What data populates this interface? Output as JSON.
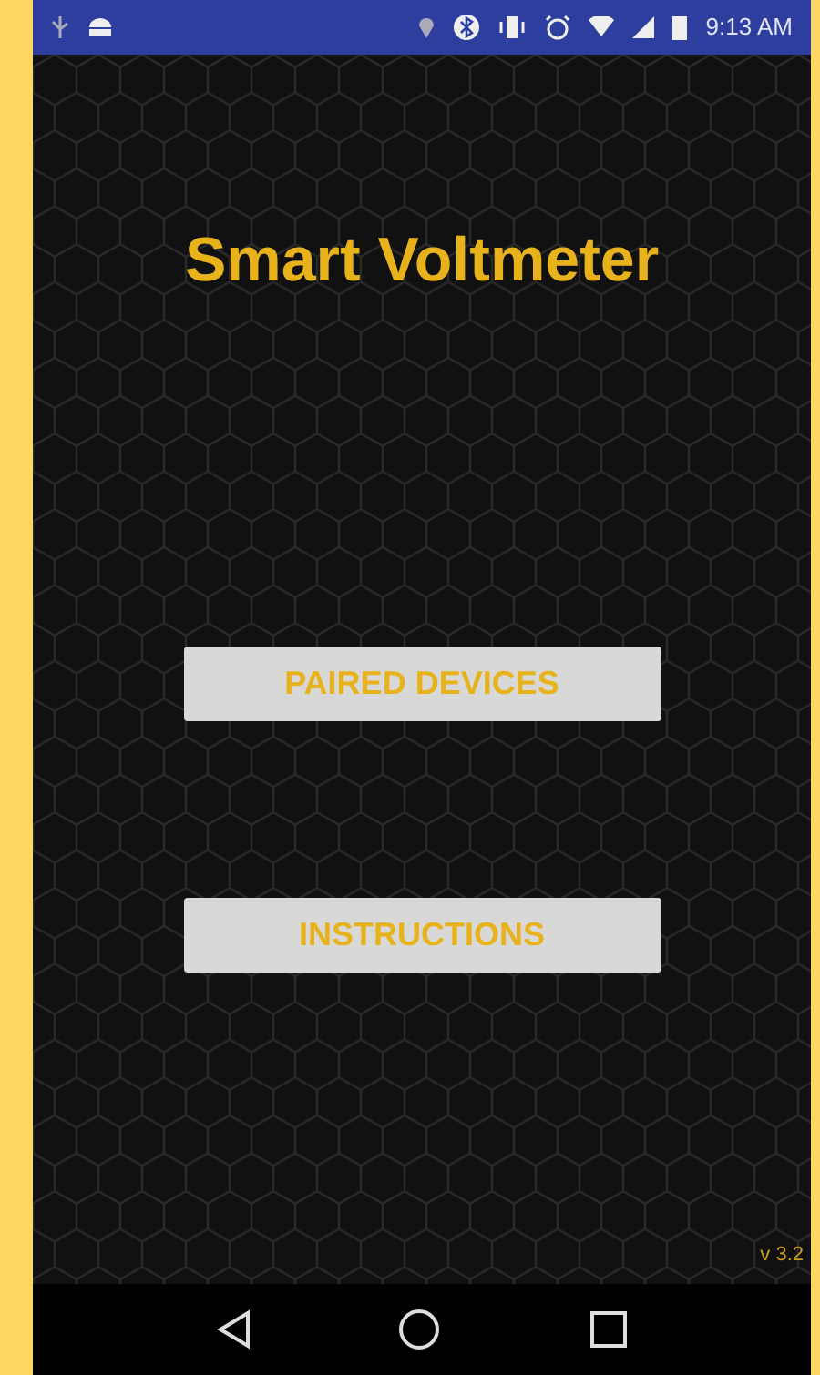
{
  "status_bar": {
    "time": "9:13 AM"
  },
  "title": "Smart Voltmeter",
  "buttons": [
    {
      "label": "PAIRED DEVICES"
    },
    {
      "label": "INSTRUCTIONS"
    }
  ],
  "version": "v 3.2"
}
